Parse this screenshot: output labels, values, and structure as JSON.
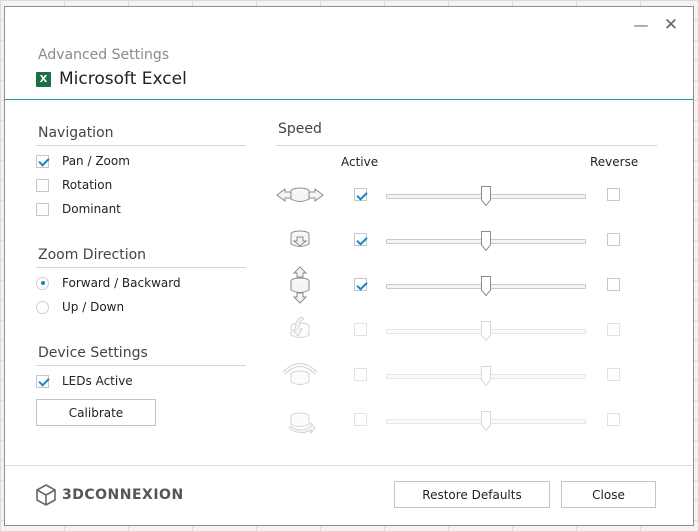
{
  "window": {
    "subtitle": "Advanced Settings",
    "app_name": "Microsoft Excel",
    "app_icon": "excel-icon",
    "minimize_glyph": "—",
    "close_glyph": "✕"
  },
  "navigation": {
    "title": "Navigation",
    "items": [
      {
        "label": "Pan / Zoom",
        "checked": true
      },
      {
        "label": "Rotation",
        "checked": false
      },
      {
        "label": "Dominant",
        "checked": false
      }
    ]
  },
  "zoom_direction": {
    "title": "Zoom Direction",
    "options": [
      {
        "label": "Forward / Backward",
        "selected": true
      },
      {
        "label": "Up / Down",
        "selected": false
      }
    ]
  },
  "device_settings": {
    "title": "Device Settings",
    "leds_label": "LEDs Active",
    "leds_checked": true,
    "calibrate_label": "Calibrate"
  },
  "speed": {
    "title": "Speed",
    "active_header": "Active",
    "reverse_header": "Reverse",
    "axes": [
      {
        "icon": "pan-left-right-axis-icon",
        "active": true,
        "reverse": false,
        "speed": 0.5
      },
      {
        "icon": "zoom-forward-backward-axis-icon",
        "active": true,
        "reverse": false,
        "speed": 0.5
      },
      {
        "icon": "pan-up-down-axis-icon",
        "active": true,
        "reverse": false,
        "speed": 0.5
      },
      {
        "icon": "tilt-axis-icon",
        "active": false,
        "reverse": false,
        "speed": 0.5
      },
      {
        "icon": "roll-axis-icon",
        "active": false,
        "reverse": false,
        "speed": 0.5
      },
      {
        "icon": "spin-axis-icon",
        "active": false,
        "reverse": false,
        "speed": 0.5
      }
    ]
  },
  "footer": {
    "logo_text": "3DCONNEXION",
    "restore_label": "Restore Defaults",
    "close_label": "Close"
  },
  "colors": {
    "accent": "#1b86c5",
    "header_separator": "#1e9b9b",
    "excel_green": "#1d7044"
  }
}
